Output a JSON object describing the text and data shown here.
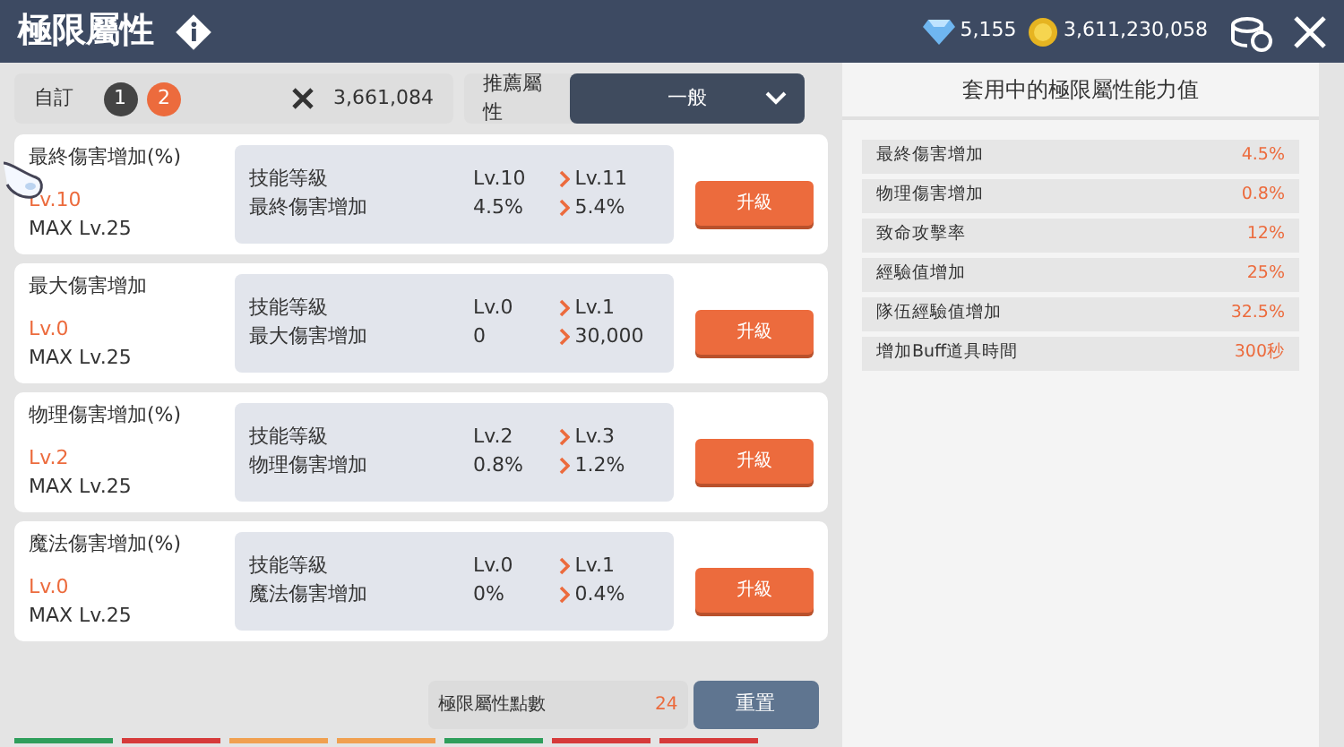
{
  "header": {
    "title": "極限屬性",
    "currencies": [
      {
        "kind": "diamond",
        "amount": "5,155"
      },
      {
        "kind": "gold",
        "amount": "3,611,230,058"
      }
    ]
  },
  "toolbar": {
    "preset_label": "自訂",
    "presets": [
      {
        "label": "1",
        "selected": false
      },
      {
        "label": "2",
        "selected": true
      }
    ],
    "combat_power": "3,661,084",
    "recommend_label": "推薦屬性",
    "recommend_value": "一般"
  },
  "skills": [
    {
      "name": "最終傷害增加(%)",
      "level": "Lv.10",
      "max": "MAX Lv.25",
      "rows": [
        {
          "label": "技能等級",
          "current": "Lv.10",
          "next": "Lv.11"
        },
        {
          "label": "最終傷害增加",
          "current": "4.5%",
          "next": "5.4%"
        }
      ],
      "button": "升級"
    },
    {
      "name": "最大傷害增加",
      "level": "Lv.0",
      "max": "MAX Lv.25",
      "rows": [
        {
          "label": "技能等級",
          "current": "Lv.0",
          "next": "Lv.1"
        },
        {
          "label": "最大傷害增加",
          "current": "0",
          "next": "30,000"
        }
      ],
      "button": "升級"
    },
    {
      "name": "物理傷害增加(%)",
      "level": "Lv.2",
      "max": "MAX Lv.25",
      "rows": [
        {
          "label": "技能等級",
          "current": "Lv.2",
          "next": "Lv.3"
        },
        {
          "label": "物理傷害增加",
          "current": "0.8%",
          "next": "1.2%"
        }
      ],
      "button": "升級"
    },
    {
      "name": "魔法傷害增加(%)",
      "level": "Lv.0",
      "max": "MAX Lv.25",
      "rows": [
        {
          "label": "技能等級",
          "current": "Lv.0",
          "next": "Lv.1"
        },
        {
          "label": "魔法傷害增加",
          "current": "0%",
          "next": "0.4%"
        }
      ],
      "button": "升級"
    }
  ],
  "points": {
    "label": "極限屬性點數",
    "value": "24",
    "button": "重置"
  },
  "applied": {
    "title": "套用中的極限屬性能力值",
    "stats": [
      {
        "label": "最終傷害增加",
        "value": "4.5%"
      },
      {
        "label": "物理傷害增加",
        "value": "0.8%"
      },
      {
        "label": "致命攻擊率",
        "value": "12%"
      },
      {
        "label": "經驗值增加",
        "value": "25%"
      },
      {
        "label": "隊伍經驗值增加",
        "value": "32.5%"
      },
      {
        "label": "增加Buff道具時間",
        "value": "300秒"
      }
    ]
  }
}
